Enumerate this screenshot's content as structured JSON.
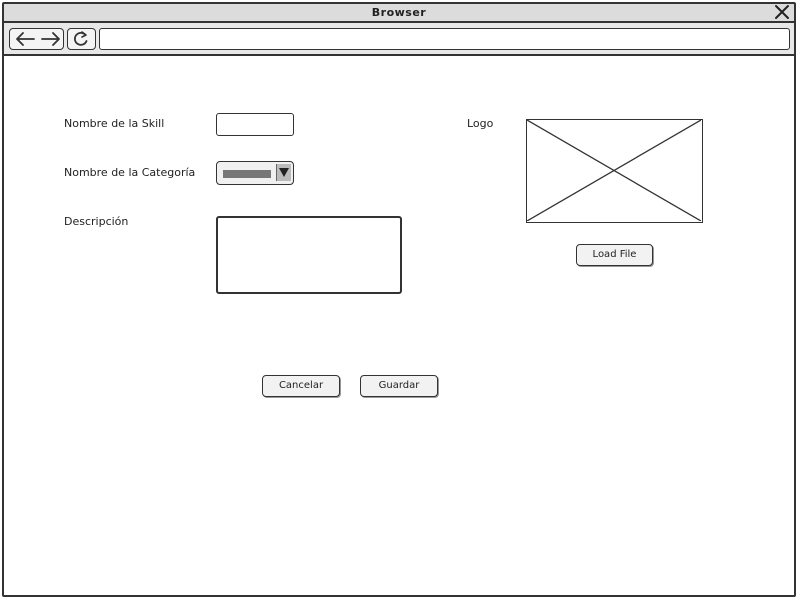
{
  "window": {
    "title": "Browser",
    "url": ""
  },
  "icons": {
    "close": "close-icon",
    "back": "arrow-left-icon",
    "forward": "arrow-right-icon",
    "reload": "reload-icon",
    "dropdown": "chevron-down-icon",
    "image_placeholder": "image-placeholder-icon"
  },
  "form": {
    "skill_name_label": "Nombre de la Skill",
    "skill_name_value": "",
    "category_label": "Nombre de la Categoría",
    "description_label": "Descripción",
    "description_value": "",
    "logo_label": "Logo",
    "load_file_label": "Load File",
    "cancel_label": "Cancelar",
    "save_label": "Guardar"
  }
}
